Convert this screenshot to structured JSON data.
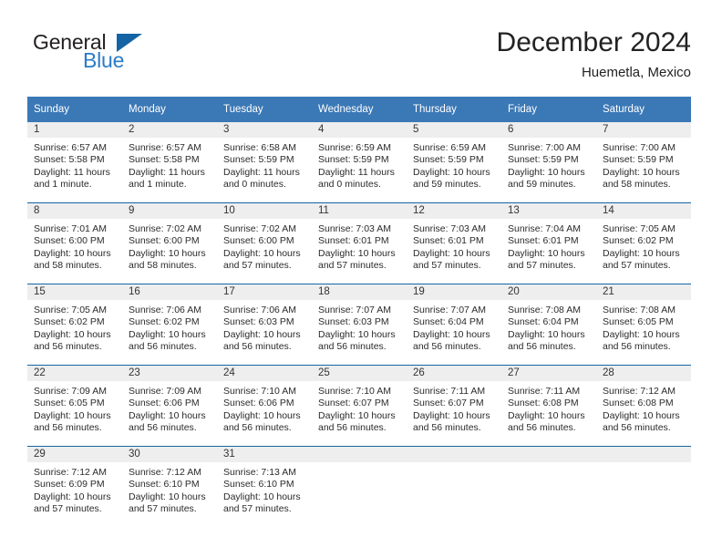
{
  "brand": {
    "name_top": "General",
    "name_bottom": "Blue",
    "accent_color": "#2a7cc7",
    "triangle_color": "#1464a5"
  },
  "header": {
    "title": "December 2024",
    "subtitle": "Huemetla, Mexico"
  },
  "theme": {
    "header_blue": "#3b78b6",
    "row_divider": "#1464a5",
    "daynum_strip": "#eeeeee"
  },
  "weekdays": [
    "Sunday",
    "Monday",
    "Tuesday",
    "Wednesday",
    "Thursday",
    "Friday",
    "Saturday"
  ],
  "weeks": [
    [
      {
        "day": "1",
        "sunrise": "Sunrise: 6:57 AM",
        "sunset": "Sunset: 5:58 PM",
        "daylight_1": "Daylight: 11 hours",
        "daylight_2": "and 1 minute."
      },
      {
        "day": "2",
        "sunrise": "Sunrise: 6:57 AM",
        "sunset": "Sunset: 5:58 PM",
        "daylight_1": "Daylight: 11 hours",
        "daylight_2": "and 1 minute."
      },
      {
        "day": "3",
        "sunrise": "Sunrise: 6:58 AM",
        "sunset": "Sunset: 5:59 PM",
        "daylight_1": "Daylight: 11 hours",
        "daylight_2": "and 0 minutes."
      },
      {
        "day": "4",
        "sunrise": "Sunrise: 6:59 AM",
        "sunset": "Sunset: 5:59 PM",
        "daylight_1": "Daylight: 11 hours",
        "daylight_2": "and 0 minutes."
      },
      {
        "day": "5",
        "sunrise": "Sunrise: 6:59 AM",
        "sunset": "Sunset: 5:59 PM",
        "daylight_1": "Daylight: 10 hours",
        "daylight_2": "and 59 minutes."
      },
      {
        "day": "6",
        "sunrise": "Sunrise: 7:00 AM",
        "sunset": "Sunset: 5:59 PM",
        "daylight_1": "Daylight: 10 hours",
        "daylight_2": "and 59 minutes."
      },
      {
        "day": "7",
        "sunrise": "Sunrise: 7:00 AM",
        "sunset": "Sunset: 5:59 PM",
        "daylight_1": "Daylight: 10 hours",
        "daylight_2": "and 58 minutes."
      }
    ],
    [
      {
        "day": "8",
        "sunrise": "Sunrise: 7:01 AM",
        "sunset": "Sunset: 6:00 PM",
        "daylight_1": "Daylight: 10 hours",
        "daylight_2": "and 58 minutes."
      },
      {
        "day": "9",
        "sunrise": "Sunrise: 7:02 AM",
        "sunset": "Sunset: 6:00 PM",
        "daylight_1": "Daylight: 10 hours",
        "daylight_2": "and 58 minutes."
      },
      {
        "day": "10",
        "sunrise": "Sunrise: 7:02 AM",
        "sunset": "Sunset: 6:00 PM",
        "daylight_1": "Daylight: 10 hours",
        "daylight_2": "and 57 minutes."
      },
      {
        "day": "11",
        "sunrise": "Sunrise: 7:03 AM",
        "sunset": "Sunset: 6:01 PM",
        "daylight_1": "Daylight: 10 hours",
        "daylight_2": "and 57 minutes."
      },
      {
        "day": "12",
        "sunrise": "Sunrise: 7:03 AM",
        "sunset": "Sunset: 6:01 PM",
        "daylight_1": "Daylight: 10 hours",
        "daylight_2": "and 57 minutes."
      },
      {
        "day": "13",
        "sunrise": "Sunrise: 7:04 AM",
        "sunset": "Sunset: 6:01 PM",
        "daylight_1": "Daylight: 10 hours",
        "daylight_2": "and 57 minutes."
      },
      {
        "day": "14",
        "sunrise": "Sunrise: 7:05 AM",
        "sunset": "Sunset: 6:02 PM",
        "daylight_1": "Daylight: 10 hours",
        "daylight_2": "and 57 minutes."
      }
    ],
    [
      {
        "day": "15",
        "sunrise": "Sunrise: 7:05 AM",
        "sunset": "Sunset: 6:02 PM",
        "daylight_1": "Daylight: 10 hours",
        "daylight_2": "and 56 minutes."
      },
      {
        "day": "16",
        "sunrise": "Sunrise: 7:06 AM",
        "sunset": "Sunset: 6:02 PM",
        "daylight_1": "Daylight: 10 hours",
        "daylight_2": "and 56 minutes."
      },
      {
        "day": "17",
        "sunrise": "Sunrise: 7:06 AM",
        "sunset": "Sunset: 6:03 PM",
        "daylight_1": "Daylight: 10 hours",
        "daylight_2": "and 56 minutes."
      },
      {
        "day": "18",
        "sunrise": "Sunrise: 7:07 AM",
        "sunset": "Sunset: 6:03 PM",
        "daylight_1": "Daylight: 10 hours",
        "daylight_2": "and 56 minutes."
      },
      {
        "day": "19",
        "sunrise": "Sunrise: 7:07 AM",
        "sunset": "Sunset: 6:04 PM",
        "daylight_1": "Daylight: 10 hours",
        "daylight_2": "and 56 minutes."
      },
      {
        "day": "20",
        "sunrise": "Sunrise: 7:08 AM",
        "sunset": "Sunset: 6:04 PM",
        "daylight_1": "Daylight: 10 hours",
        "daylight_2": "and 56 minutes."
      },
      {
        "day": "21",
        "sunrise": "Sunrise: 7:08 AM",
        "sunset": "Sunset: 6:05 PM",
        "daylight_1": "Daylight: 10 hours",
        "daylight_2": "and 56 minutes."
      }
    ],
    [
      {
        "day": "22",
        "sunrise": "Sunrise: 7:09 AM",
        "sunset": "Sunset: 6:05 PM",
        "daylight_1": "Daylight: 10 hours",
        "daylight_2": "and 56 minutes."
      },
      {
        "day": "23",
        "sunrise": "Sunrise: 7:09 AM",
        "sunset": "Sunset: 6:06 PM",
        "daylight_1": "Daylight: 10 hours",
        "daylight_2": "and 56 minutes."
      },
      {
        "day": "24",
        "sunrise": "Sunrise: 7:10 AM",
        "sunset": "Sunset: 6:06 PM",
        "daylight_1": "Daylight: 10 hours",
        "daylight_2": "and 56 minutes."
      },
      {
        "day": "25",
        "sunrise": "Sunrise: 7:10 AM",
        "sunset": "Sunset: 6:07 PM",
        "daylight_1": "Daylight: 10 hours",
        "daylight_2": "and 56 minutes."
      },
      {
        "day": "26",
        "sunrise": "Sunrise: 7:11 AM",
        "sunset": "Sunset: 6:07 PM",
        "daylight_1": "Daylight: 10 hours",
        "daylight_2": "and 56 minutes."
      },
      {
        "day": "27",
        "sunrise": "Sunrise: 7:11 AM",
        "sunset": "Sunset: 6:08 PM",
        "daylight_1": "Daylight: 10 hours",
        "daylight_2": "and 56 minutes."
      },
      {
        "day": "28",
        "sunrise": "Sunrise: 7:12 AM",
        "sunset": "Sunset: 6:08 PM",
        "daylight_1": "Daylight: 10 hours",
        "daylight_2": "and 56 minutes."
      }
    ],
    [
      {
        "day": "29",
        "sunrise": "Sunrise: 7:12 AM",
        "sunset": "Sunset: 6:09 PM",
        "daylight_1": "Daylight: 10 hours",
        "daylight_2": "and 57 minutes."
      },
      {
        "day": "30",
        "sunrise": "Sunrise: 7:12 AM",
        "sunset": "Sunset: 6:10 PM",
        "daylight_1": "Daylight: 10 hours",
        "daylight_2": "and 57 minutes."
      },
      {
        "day": "31",
        "sunrise": "Sunrise: 7:13 AM",
        "sunset": "Sunset: 6:10 PM",
        "daylight_1": "Daylight: 10 hours",
        "daylight_2": "and 57 minutes."
      },
      {
        "day": "",
        "sunrise": "",
        "sunset": "",
        "daylight_1": "",
        "daylight_2": ""
      },
      {
        "day": "",
        "sunrise": "",
        "sunset": "",
        "daylight_1": "",
        "daylight_2": ""
      },
      {
        "day": "",
        "sunrise": "",
        "sunset": "",
        "daylight_1": "",
        "daylight_2": ""
      },
      {
        "day": "",
        "sunrise": "",
        "sunset": "",
        "daylight_1": "",
        "daylight_2": ""
      }
    ]
  ]
}
